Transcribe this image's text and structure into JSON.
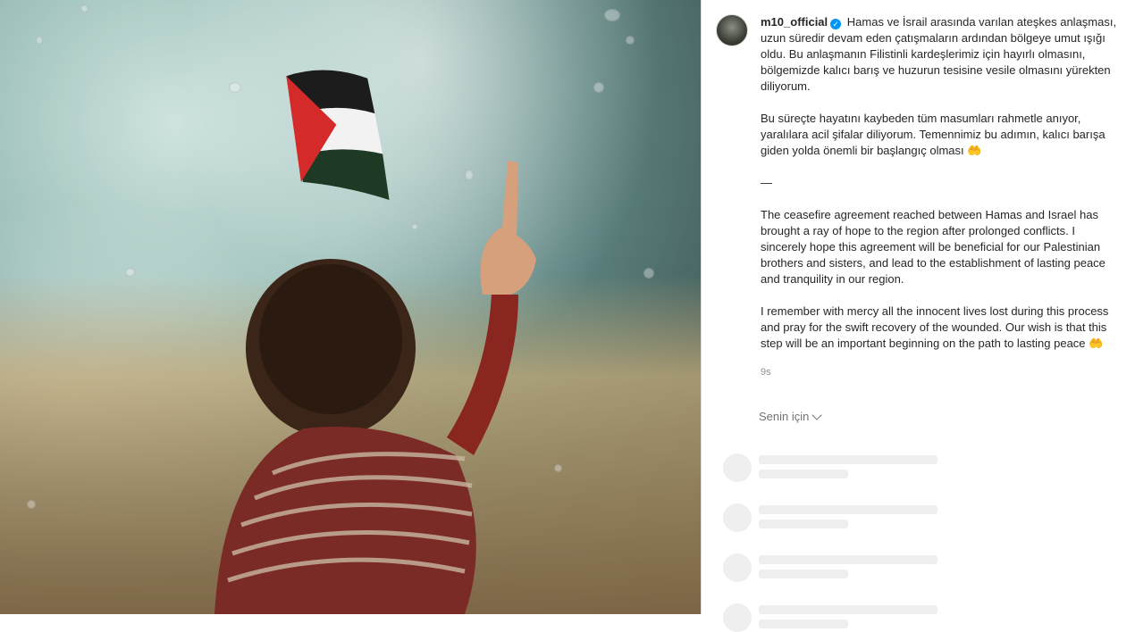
{
  "post": {
    "username": "m10_official",
    "verified_icon": "verified-badge-icon",
    "caption_paragraphs": [
      "Hamas ve İsrail arasında varılan ateşkes anlaşması, uzun süredir devam eden çatışmaların ardından bölgeye umut ışığı oldu. Bu anlaşmanın Filistinli kardeşlerimiz için hayırlı olmasını, bölgemizde kalıcı barış ve huzurun tesisine vesile olmasını yürekten diliyorum.",
      "Bu süreçte hayatını kaybeden tüm masumları rahmetle anıyor, yaralılara acil şifalar diliyorum. Temennimiz bu adımın, kalıcı barışa giden yolda önemli bir başlangıç olması 🤲",
      "—",
      "The ceasefire agreement reached between Hamas and Israel has brought a ray of hope to the region after prolonged conflicts. I sincerely hope this agreement will be beneficial for our Palestinian brothers and sisters, and lead to the establishment of lasting peace and tranquility in our region.",
      "I remember with mercy all the innocent lives lost during this process and pray for the swift recovery of the wounded. Our wish is that this step will be an important beginning on the path to lasting peace 🤲"
    ],
    "timestamp": "9s"
  },
  "for_you": {
    "label": "Senin için",
    "icon": "chevron-down-icon"
  },
  "colors": {
    "verified": "#0095f6",
    "secondary_text": "#737373",
    "skeleton": "#efefef"
  }
}
